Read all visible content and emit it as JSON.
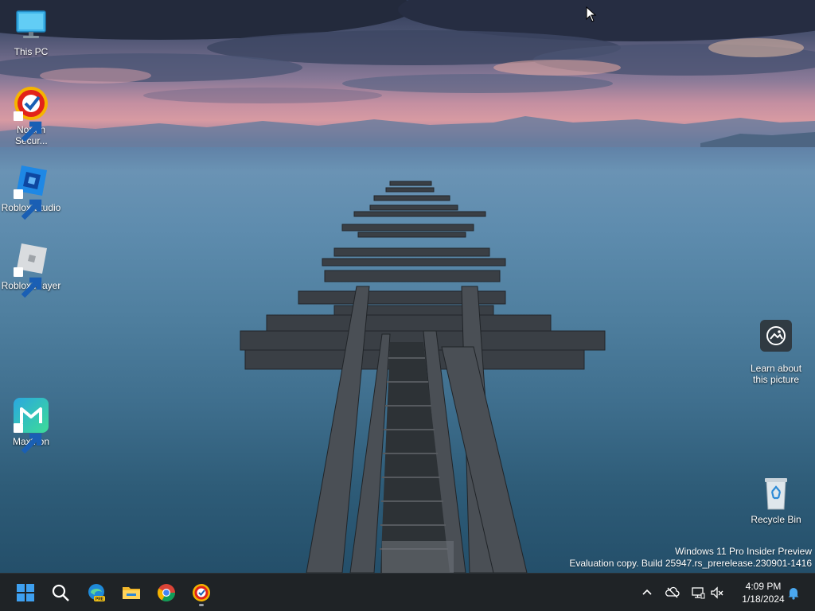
{
  "desktop": {
    "icons": [
      {
        "label": "This PC",
        "icon": "monitor-icon"
      },
      {
        "label": "Norton Secur...",
        "icon": "norton-icon"
      },
      {
        "label": "Roblox Studio",
        "icon": "roblox-studio-icon"
      },
      {
        "label": "Roblox Player",
        "icon": "roblox-player-icon"
      },
      {
        "label": "Maxthon",
        "icon": "maxthon-icon"
      }
    ],
    "learn_about": "Learn about this picture",
    "recycle_bin": "Recycle Bin"
  },
  "watermark": {
    "line1": "Windows 11 Pro Insider Preview",
    "line2": "Evaluation copy. Build 25947.rs_prerelease.230901-1416"
  },
  "taskbar": {
    "apps": [
      "start-icon",
      "search-icon",
      "edge-preview-icon",
      "file-explorer-icon",
      "chrome-icon",
      "norton-icon"
    ],
    "tray": [
      "chevron-up-icon",
      "onedrive-icon",
      "network-icon",
      "volume-muted-icon",
      "bell-icon"
    ],
    "time": "4:09 PM",
    "date": "1/18/2024"
  },
  "colors": {
    "taskbar": "#1f2326",
    "accent": "#0078d4"
  }
}
